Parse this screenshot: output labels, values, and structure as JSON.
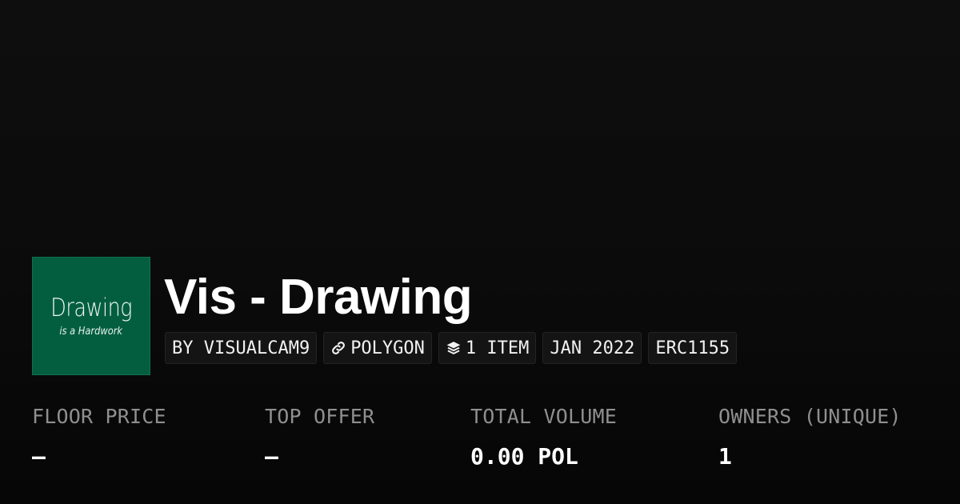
{
  "collection": {
    "name": "Vis - Drawing",
    "thumbnail": {
      "title": "Drawing",
      "subtitle": "is a Hardwork",
      "background_color": "#035e40"
    }
  },
  "tags": {
    "creator": "BY VISUALCAM9",
    "chain": {
      "icon": "chain-link-icon",
      "label": "POLYGON"
    },
    "items": {
      "icon": "layers-icon",
      "label": "1 ITEM"
    },
    "date": "JAN 2022",
    "standard": "ERC1155"
  },
  "stats": {
    "floor_price": {
      "label": "FLOOR PRICE",
      "value": "—"
    },
    "top_offer": {
      "label": "TOP OFFER",
      "value": "—"
    },
    "total_volume": {
      "label": "TOTAL VOLUME",
      "value": "0.00 POL"
    },
    "owners": {
      "label": "OWNERS (UNIQUE)",
      "value": "1"
    }
  },
  "colors": {
    "background": "#0b0b0b",
    "label_gray": "#8f8f8f",
    "tag_background": "#141414"
  }
}
